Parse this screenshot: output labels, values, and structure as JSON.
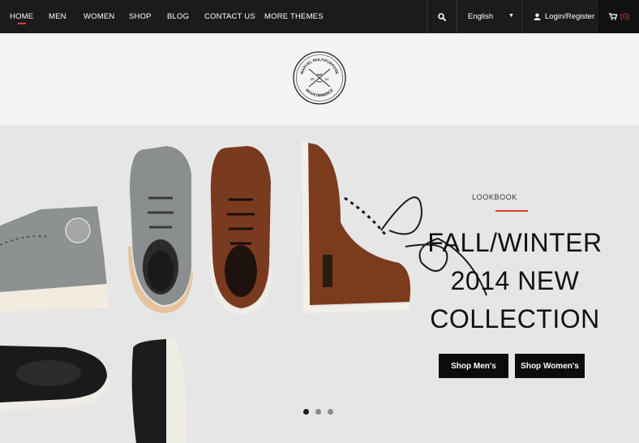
{
  "nav": {
    "items": [
      {
        "label": "HOME",
        "active": true
      },
      {
        "label": "MEN"
      },
      {
        "label": "WOMEN"
      },
      {
        "label": "SHOP"
      },
      {
        "label": "BLOG"
      },
      {
        "label": "CONTACT US"
      },
      {
        "label": "MORE THEMES"
      }
    ],
    "search_icon": "search-icon",
    "language": "English",
    "login_label": "Login/Register",
    "cart_count": "(0)"
  },
  "logo": {
    "top_text": "MARVEL MULTIPURPOSE",
    "year_left": "20",
    "year_right": "14",
    "bottom_text": "WOOCOMMERCE"
  },
  "hero": {
    "eyebrow": "LOOKBOOK",
    "headline_lines": [
      "FALL/WINTER",
      "2014 NEW",
      "COLLECTION"
    ],
    "buttons": {
      "men": "Shop Men's",
      "women": "Shop Women's"
    },
    "slide_count": 3,
    "active_slide": 1,
    "accent_color": "#e03a2f"
  }
}
